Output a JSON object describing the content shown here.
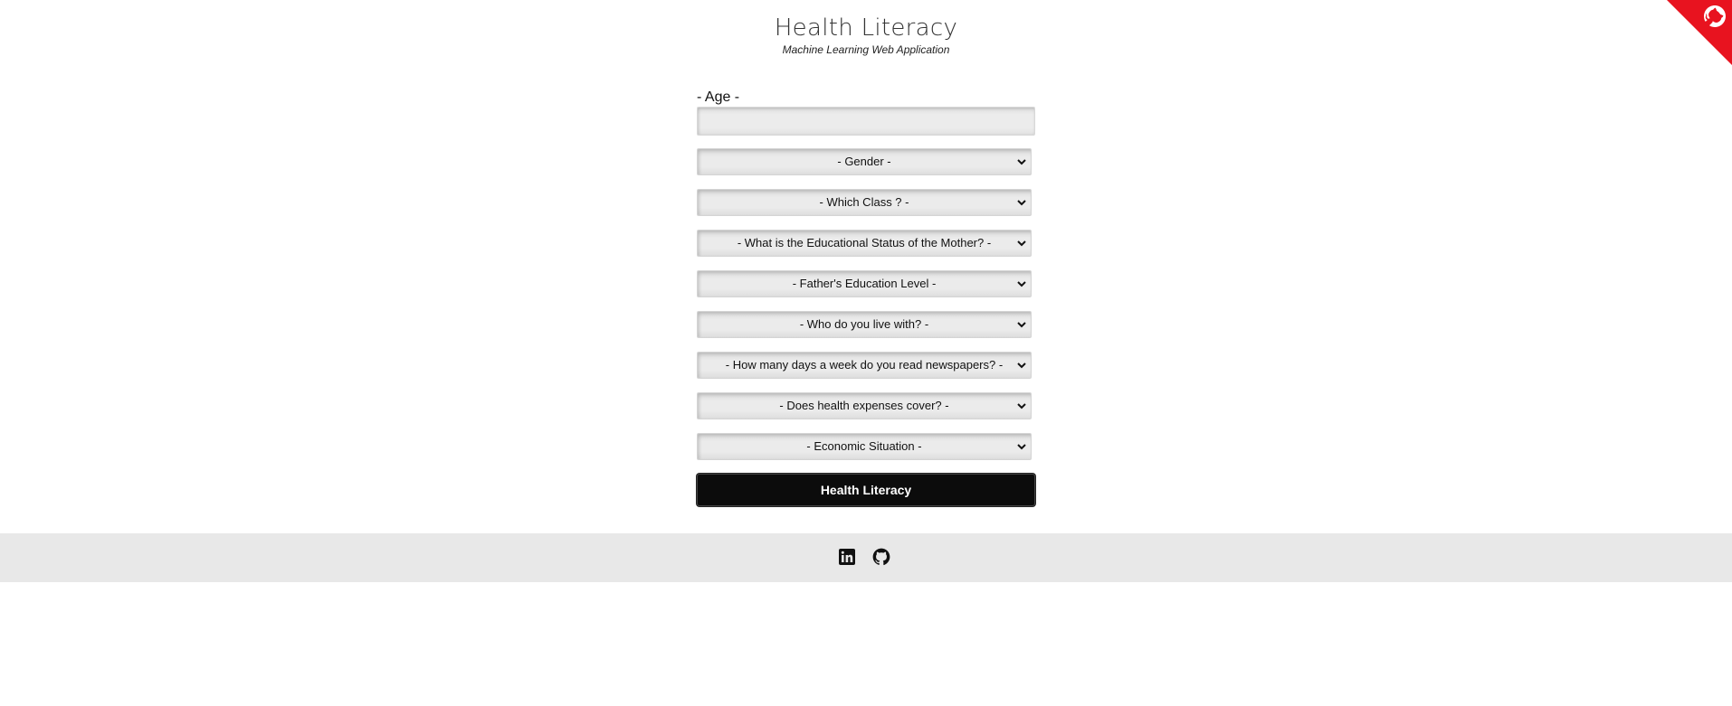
{
  "header": {
    "title": "Health Literacy",
    "subtitle": "Machine Learning Web Application"
  },
  "corner": {
    "icon": "github-octocat-icon",
    "color": "#e8131f"
  },
  "form": {
    "age_label": "- Age -",
    "age_value": "",
    "selects": [
      {
        "label": "- Gender -"
      },
      {
        "label": "- Which Class ? -"
      },
      {
        "label": "- What is the Educational Status of the Mother? -"
      },
      {
        "label": "- Father's Education Level -"
      },
      {
        "label": "- Who do you live with? -"
      },
      {
        "label": "- How many days a week do you read newspapers? -"
      },
      {
        "label": "- Does health expenses cover? -"
      },
      {
        "label": "- Economic Situation -"
      }
    ],
    "submit_label": "Health Literacy"
  },
  "footer": {
    "background": "#e8e8e8",
    "links": [
      {
        "icon": "linkedin-icon"
      },
      {
        "icon": "github-icon"
      }
    ]
  }
}
